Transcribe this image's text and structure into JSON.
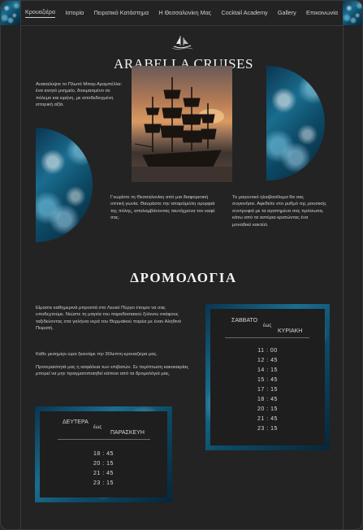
{
  "nav": {
    "items": [
      "Κρουαζιέρα",
      "Ιστορία",
      "Πειρατικό Κατάστημα",
      "Η Θεσσαλονίκη Μας",
      "Cocktail Academy",
      "Gallery",
      "Επικοινωνία"
    ]
  },
  "hero": {
    "title": "ARABELLA CRUISES",
    "intro": "Ανακαλύψτε το Πλωτό Μπαρ Αραμπέλλα: ένα κινητό μνημείο, δοκιμασμένο σε πόλεμο και ειρήνη, με αποδεδειγμένη ιστορική αξία.",
    "para2": "Γνωρίστε τη Θεσσαλονίκη από μια διαφορετική οπτική γωνία. Θαυμάστε την απαράμιλλη ομορφιά της πόλης, απολαμβάνοντας ταυτόχρονα τον καφέ σας.",
    "para3": "Το μαγευτικό ηλιοβασίλεμα θα σας συγκινήσει. Αφεθείτε στο ρυθμό της μουσικής συντροφιά με τα αγαπημένα σας πρόσωπα, κάτω από τα αστέρια κρατώντας ένα μοναδικό κοκτέιλ."
  },
  "routes": {
    "heading": "ΔΡΟΜΟΛΟΓΙΑ",
    "para1": "Είμαστε καθημερινά μπροστά στο Λευκό Πύργο έτοιμοι να σας υποδεχτούμε. Νιώστε τη μαγεία του παραδοσιακού ξύλινου σκάφους ταξιδεύοντας στα γαλήνια νερά του Θερμαϊκού παρέα με έναν Αληθινό Πειρατή.",
    "para2": "Κάθε μεσημέρι ώρα ξεκινάμε την 30λεπτη κρουαζιέρα μας.",
    "para3": "Προτεραιότητά μας η ασφάλεια των επιβατών. Σε περίπτωση κακοκαιρίας μπορεί να μην πραγματοποιηθεί κάποιο από τα δρομολόγιά μας."
  },
  "schedule_weekend": {
    "from": "ΣΑΒΒΑΤΟ",
    "mid": "έως",
    "to": "ΚΥΡΙΑΚΗ",
    "times": [
      "11 : 00",
      "12 : 45",
      "14 : 15",
      "15 : 45",
      "17 : 15",
      "18 : 45",
      "20 : 15",
      "21 : 45",
      "23 : 15"
    ]
  },
  "schedule_weekday": {
    "from": "ΔΕΥΤΕΡΑ",
    "mid": "έως",
    "to": "ΠΑΡΑΣΚΕΥΗ",
    "times": [
      "18 : 45",
      "20 : 15",
      "21 : 45",
      "23 : 15"
    ]
  },
  "colors": {
    "background": "#232323",
    "text": "#cfcfcf",
    "heading": "#f2f2f2",
    "sea_dark": "#06263a",
    "sea_light": "#1a6d8f"
  }
}
